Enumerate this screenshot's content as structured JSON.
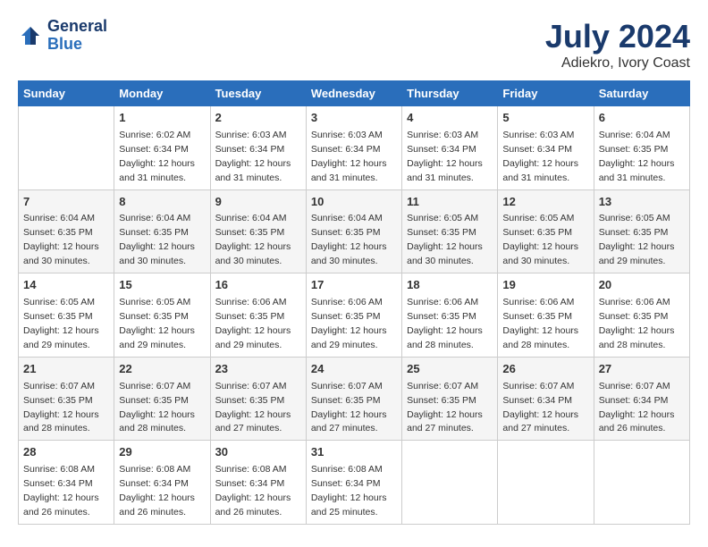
{
  "header": {
    "logo_general": "General",
    "logo_blue": "Blue",
    "main_title": "July 2024",
    "subtitle": "Adiekro, Ivory Coast"
  },
  "columns": [
    "Sunday",
    "Monday",
    "Tuesday",
    "Wednesday",
    "Thursday",
    "Friday",
    "Saturday"
  ],
  "weeks": [
    [
      {
        "day": "",
        "info": ""
      },
      {
        "day": "1",
        "info": "Sunrise: 6:02 AM\nSunset: 6:34 PM\nDaylight: 12 hours\nand 31 minutes."
      },
      {
        "day": "2",
        "info": "Sunrise: 6:03 AM\nSunset: 6:34 PM\nDaylight: 12 hours\nand 31 minutes."
      },
      {
        "day": "3",
        "info": "Sunrise: 6:03 AM\nSunset: 6:34 PM\nDaylight: 12 hours\nand 31 minutes."
      },
      {
        "day": "4",
        "info": "Sunrise: 6:03 AM\nSunset: 6:34 PM\nDaylight: 12 hours\nand 31 minutes."
      },
      {
        "day": "5",
        "info": "Sunrise: 6:03 AM\nSunset: 6:34 PM\nDaylight: 12 hours\nand 31 minutes."
      },
      {
        "day": "6",
        "info": "Sunrise: 6:04 AM\nSunset: 6:35 PM\nDaylight: 12 hours\nand 31 minutes."
      }
    ],
    [
      {
        "day": "7",
        "info": "Sunrise: 6:04 AM\nSunset: 6:35 PM\nDaylight: 12 hours\nand 30 minutes."
      },
      {
        "day": "8",
        "info": "Sunrise: 6:04 AM\nSunset: 6:35 PM\nDaylight: 12 hours\nand 30 minutes."
      },
      {
        "day": "9",
        "info": "Sunrise: 6:04 AM\nSunset: 6:35 PM\nDaylight: 12 hours\nand 30 minutes."
      },
      {
        "day": "10",
        "info": "Sunrise: 6:04 AM\nSunset: 6:35 PM\nDaylight: 12 hours\nand 30 minutes."
      },
      {
        "day": "11",
        "info": "Sunrise: 6:05 AM\nSunset: 6:35 PM\nDaylight: 12 hours\nand 30 minutes."
      },
      {
        "day": "12",
        "info": "Sunrise: 6:05 AM\nSunset: 6:35 PM\nDaylight: 12 hours\nand 30 minutes."
      },
      {
        "day": "13",
        "info": "Sunrise: 6:05 AM\nSunset: 6:35 PM\nDaylight: 12 hours\nand 29 minutes."
      }
    ],
    [
      {
        "day": "14",
        "info": "Sunrise: 6:05 AM\nSunset: 6:35 PM\nDaylight: 12 hours\nand 29 minutes."
      },
      {
        "day": "15",
        "info": "Sunrise: 6:05 AM\nSunset: 6:35 PM\nDaylight: 12 hours\nand 29 minutes."
      },
      {
        "day": "16",
        "info": "Sunrise: 6:06 AM\nSunset: 6:35 PM\nDaylight: 12 hours\nand 29 minutes."
      },
      {
        "day": "17",
        "info": "Sunrise: 6:06 AM\nSunset: 6:35 PM\nDaylight: 12 hours\nand 29 minutes."
      },
      {
        "day": "18",
        "info": "Sunrise: 6:06 AM\nSunset: 6:35 PM\nDaylight: 12 hours\nand 28 minutes."
      },
      {
        "day": "19",
        "info": "Sunrise: 6:06 AM\nSunset: 6:35 PM\nDaylight: 12 hours\nand 28 minutes."
      },
      {
        "day": "20",
        "info": "Sunrise: 6:06 AM\nSunset: 6:35 PM\nDaylight: 12 hours\nand 28 minutes."
      }
    ],
    [
      {
        "day": "21",
        "info": "Sunrise: 6:07 AM\nSunset: 6:35 PM\nDaylight: 12 hours\nand 28 minutes."
      },
      {
        "day": "22",
        "info": "Sunrise: 6:07 AM\nSunset: 6:35 PM\nDaylight: 12 hours\nand 28 minutes."
      },
      {
        "day": "23",
        "info": "Sunrise: 6:07 AM\nSunset: 6:35 PM\nDaylight: 12 hours\nand 27 minutes."
      },
      {
        "day": "24",
        "info": "Sunrise: 6:07 AM\nSunset: 6:35 PM\nDaylight: 12 hours\nand 27 minutes."
      },
      {
        "day": "25",
        "info": "Sunrise: 6:07 AM\nSunset: 6:35 PM\nDaylight: 12 hours\nand 27 minutes."
      },
      {
        "day": "26",
        "info": "Sunrise: 6:07 AM\nSunset: 6:34 PM\nDaylight: 12 hours\nand 27 minutes."
      },
      {
        "day": "27",
        "info": "Sunrise: 6:07 AM\nSunset: 6:34 PM\nDaylight: 12 hours\nand 26 minutes."
      }
    ],
    [
      {
        "day": "28",
        "info": "Sunrise: 6:08 AM\nSunset: 6:34 PM\nDaylight: 12 hours\nand 26 minutes."
      },
      {
        "day": "29",
        "info": "Sunrise: 6:08 AM\nSunset: 6:34 PM\nDaylight: 12 hours\nand 26 minutes."
      },
      {
        "day": "30",
        "info": "Sunrise: 6:08 AM\nSunset: 6:34 PM\nDaylight: 12 hours\nand 26 minutes."
      },
      {
        "day": "31",
        "info": "Sunrise: 6:08 AM\nSunset: 6:34 PM\nDaylight: 12 hours\nand 25 minutes."
      },
      {
        "day": "",
        "info": ""
      },
      {
        "day": "",
        "info": ""
      },
      {
        "day": "",
        "info": ""
      }
    ]
  ]
}
